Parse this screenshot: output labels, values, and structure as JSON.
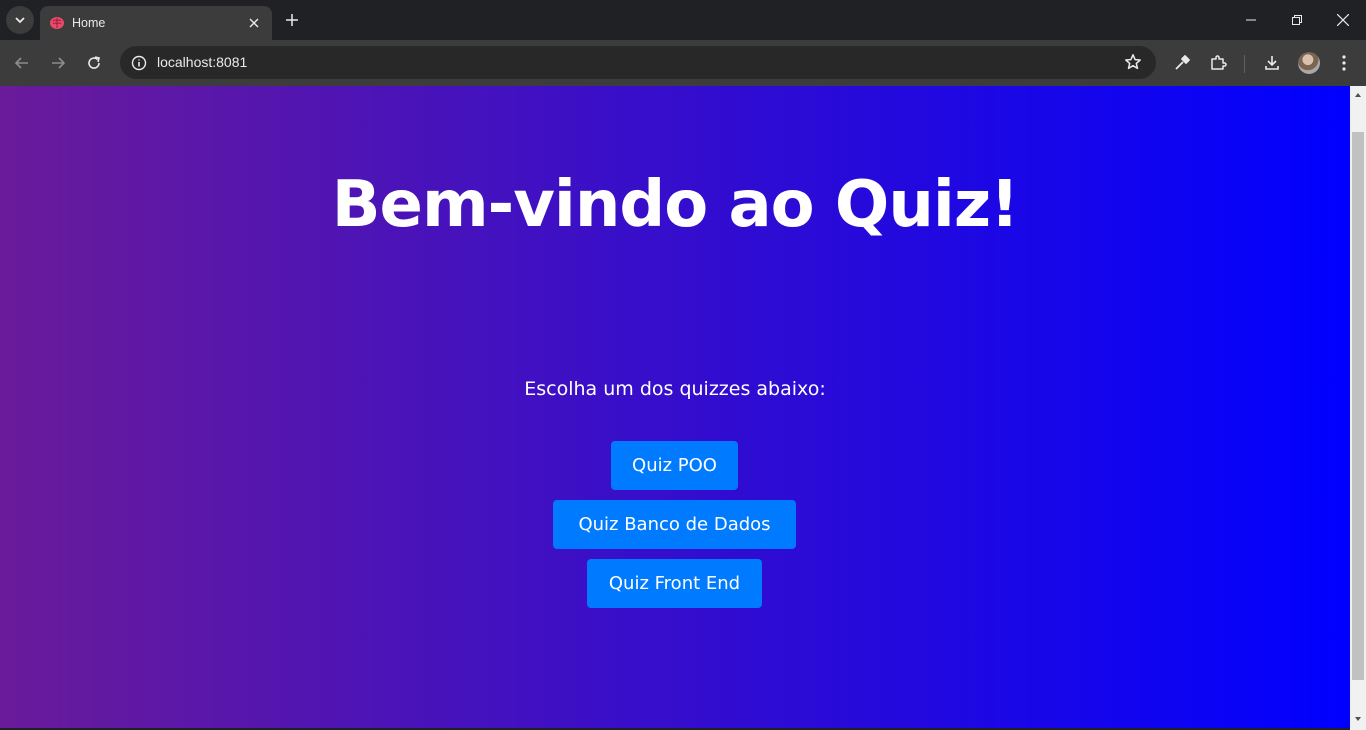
{
  "browser": {
    "tab": {
      "title": "Home"
    },
    "address_bar": {
      "url": "localhost:8081"
    }
  },
  "page": {
    "headline": "Bem-vindo ao Quiz!",
    "subtitle": "Escolha um dos quizzes abaixo:",
    "quizzes": [
      {
        "label": "Quiz POO"
      },
      {
        "label": "Quiz Banco de Dados"
      },
      {
        "label": "Quiz Front End"
      }
    ]
  },
  "colors": {
    "gradient_start": "#6a1b9a",
    "gradient_end": "#0000ff",
    "button_bg": "#007bff",
    "text": "#ffffff"
  },
  "icons": {
    "tab_favicon": "brain-icon",
    "tab_search": "chevron-down-icon",
    "tab_close": "close-icon",
    "new_tab": "plus-icon",
    "back": "arrow-left-icon",
    "forward": "arrow-right-icon",
    "reload": "reload-icon",
    "site_info": "info-icon",
    "bookmark": "star-icon",
    "eyedropper": "eyedropper-icon",
    "extensions": "puzzle-icon",
    "downloads": "download-icon",
    "menu": "kebab-menu-icon"
  }
}
